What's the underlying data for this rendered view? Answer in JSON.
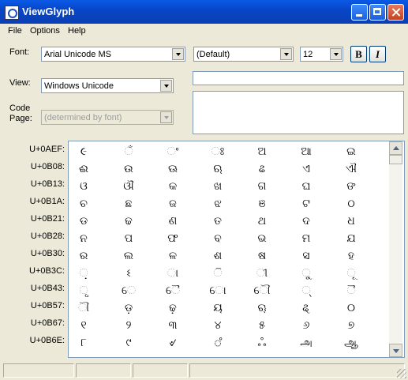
{
  "window": {
    "title": "ViewGlyph"
  },
  "menu": [
    {
      "label": "File"
    },
    {
      "label": "Options"
    },
    {
      "label": "Help"
    }
  ],
  "font_label": "Font:",
  "font_value": "Arial Unicode MS",
  "style_value": "(Default)",
  "size_value": "12",
  "bold_label": "B",
  "italic_label": "I",
  "view_label": "View:",
  "view_value": "Windows Unicode",
  "codepage_label_1": "Code",
  "codepage_label_2": "Page:",
  "codepage_value": "(determined by font)",
  "rows": [
    {
      "label": "U+0AEF:",
      "glyphs": [
        "૯",
        "ଁ",
        "ଂ",
        "ଃ",
        "ଅ",
        "ଆ",
        "ଇ"
      ]
    },
    {
      "label": "U+0B08:",
      "glyphs": [
        "ଈ",
        "ଉ",
        "ଊ",
        "ଋ",
        "ଌ",
        "ଏ",
        "ଐ"
      ]
    },
    {
      "label": "U+0B13:",
      "glyphs": [
        "ଓ",
        "ଔ",
        "କ",
        "ଖ",
        "ଗ",
        "ଘ",
        "ଙ"
      ]
    },
    {
      "label": "U+0B1A:",
      "glyphs": [
        "ଚ",
        "ଛ",
        "ଜ",
        "ଝ",
        "ଞ",
        "ଟ",
        "ଠ"
      ]
    },
    {
      "label": "U+0B21:",
      "glyphs": [
        "ଡ",
        "ଢ",
        "ଣ",
        "ତ",
        "ଥ",
        "ଦ",
        "ଧ"
      ]
    },
    {
      "label": "U+0B28:",
      "glyphs": [
        "ନ",
        "ପ",
        "ଫ",
        "ବ",
        "ଭ",
        "ମ",
        "ଯ"
      ]
    },
    {
      "label": "U+0B30:",
      "glyphs": [
        "ର",
        "ଲ",
        "ଳ",
        "ଶ",
        "ଷ",
        "ସ",
        "ହ"
      ]
    },
    {
      "label": "U+0B3C:",
      "glyphs": [
        "଼",
        "ଽ",
        "ା",
        "ି",
        "ୀ",
        "ୁ",
        "ୂ"
      ]
    },
    {
      "label": "U+0B43:",
      "glyphs": [
        "ୃ",
        "େ",
        "ୈ",
        "ୋ",
        "ୌ",
        "୍",
        "ୖ"
      ]
    },
    {
      "label": "U+0B57:",
      "glyphs": [
        "ୗ",
        "ଡ଼",
        "ଢ଼",
        "ୟ",
        "ୠ",
        "ୡ",
        "୦"
      ]
    },
    {
      "label": "U+0B67:",
      "glyphs": [
        "୧",
        "୨",
        "୩",
        "୪",
        "୫",
        "୬",
        "୭"
      ]
    },
    {
      "label": "U+0B6E:",
      "glyphs": [
        "୮",
        "୯",
        "୰",
        "ஂ",
        "ஃ",
        "அ",
        "ஆ"
      ]
    }
  ]
}
